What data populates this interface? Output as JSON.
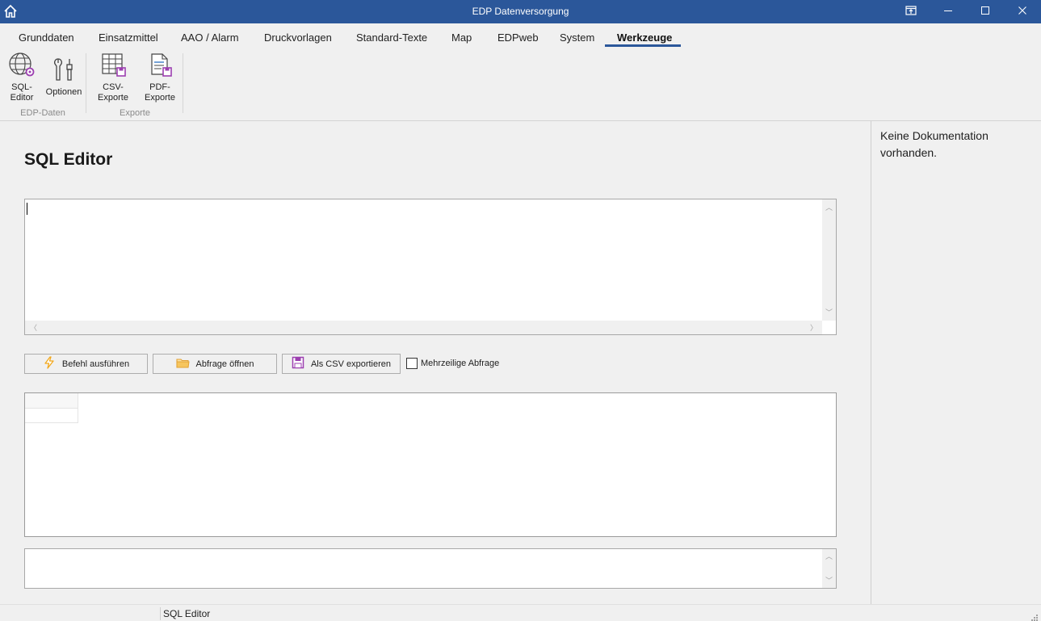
{
  "window": {
    "title": "EDP Datenversorgung",
    "home_icon": "home-icon",
    "controls": [
      "restore-to-tray-icon",
      "minimize-icon",
      "maximize-icon",
      "close-icon"
    ]
  },
  "ribbon": {
    "tabs": [
      {
        "label": "Grunddaten",
        "active": false
      },
      {
        "label": "Einsatzmittel",
        "active": false
      },
      {
        "label": "AAO / Alarm",
        "active": false
      },
      {
        "label": "Druckvorlagen",
        "active": false
      },
      {
        "label": "Standard-Texte",
        "active": false
      },
      {
        "label": "Map",
        "active": false
      },
      {
        "label": "EDPweb",
        "active": false
      },
      {
        "label": "System",
        "active": false
      },
      {
        "label": "Werkzeuge",
        "active": true
      }
    ],
    "groups": [
      {
        "label": "EDP-Daten",
        "buttons": [
          {
            "label_line1": "SQL-",
            "label_line2": "Editor",
            "icon": "globe-gear-icon"
          },
          {
            "label_line1": "Optionen",
            "label_line2": "",
            "icon": "tools-icon"
          }
        ]
      },
      {
        "label": "Exporte",
        "buttons": [
          {
            "label_line1": "CSV-",
            "label_line2": "Exporte",
            "icon": "table-save-icon"
          },
          {
            "label_line1": "PDF-",
            "label_line2": "Exporte",
            "icon": "document-save-icon"
          }
        ]
      }
    ]
  },
  "main": {
    "heading": "SQL Editor",
    "editor_value": "",
    "buttons": {
      "execute": "Befehl ausführen",
      "open": "Abfrage öffnen",
      "export_csv": "Als CSV exportieren"
    },
    "multiline_checkbox": {
      "label": "Mehrzeilige Abfrage",
      "checked": false
    },
    "message_value": ""
  },
  "doc_panel": {
    "text": "Keine Dokumentation vorhanden."
  },
  "statusbar": {
    "text": "SQL Editor"
  },
  "colors": {
    "titlebar": "#2b579a",
    "tab_underline": "#2b579a",
    "lightning": "#f2a81d",
    "folder": "#f0b94a",
    "save_purple": "#9c3fb0"
  }
}
